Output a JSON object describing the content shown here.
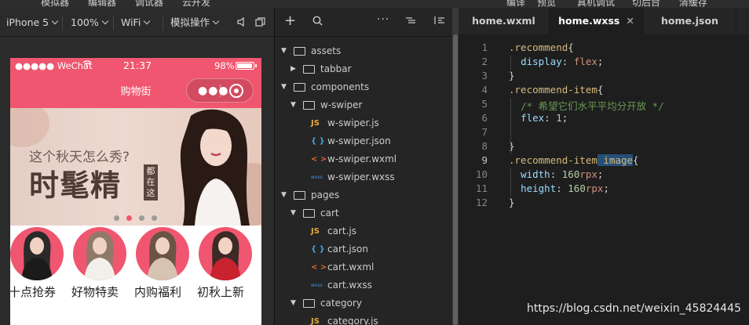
{
  "top_menu": [
    "模拟器",
    "编辑器",
    "调试器",
    "云开发",
    "编译",
    "预览",
    "真机调试",
    "切后台",
    "清缓存"
  ],
  "sim_toolbar": {
    "device": "iPhone 5",
    "zoom": "100%",
    "network": "WiFi",
    "operation": "模拟操作"
  },
  "phone": {
    "carrier": "●●●●● WeChat",
    "time": "21:37",
    "battery_text": "98%",
    "battery_level": 0.98,
    "nav_title": "购物街",
    "banner": {
      "subtitle": "这个秋天怎么秀?",
      "headline": "时髦精",
      "stamp": "都在这",
      "dots_count": 4,
      "active_dot": 1
    },
    "recommend": [
      {
        "label": "十点抢券"
      },
      {
        "label": "好物特卖"
      },
      {
        "label": "内购福利"
      },
      {
        "label": "初秋上新"
      }
    ]
  },
  "explorer": {
    "tree": [
      {
        "name": "assets",
        "type": "folder",
        "open": true,
        "depth": 0
      },
      {
        "name": "tabbar",
        "type": "folder",
        "open": false,
        "depth": 1
      },
      {
        "name": "components",
        "type": "folder",
        "open": true,
        "depth": 0
      },
      {
        "name": "w-swiper",
        "type": "folder",
        "open": true,
        "depth": 1
      },
      {
        "name": "w-swiper.js",
        "type": "js",
        "depth": 2
      },
      {
        "name": "w-swiper.json",
        "type": "json",
        "depth": 2
      },
      {
        "name": "w-swiper.wxml",
        "type": "wxml",
        "depth": 2
      },
      {
        "name": "w-swiper.wxss",
        "type": "wxss",
        "depth": 2
      },
      {
        "name": "pages",
        "type": "folder",
        "open": true,
        "depth": 0
      },
      {
        "name": "cart",
        "type": "folder",
        "open": true,
        "depth": 1
      },
      {
        "name": "cart.js",
        "type": "js",
        "depth": 2
      },
      {
        "name": "cart.json",
        "type": "json",
        "depth": 2
      },
      {
        "name": "cart.wxml",
        "type": "wxml",
        "depth": 2
      },
      {
        "name": "cart.wxss",
        "type": "wxss",
        "depth": 2
      },
      {
        "name": "category",
        "type": "folder",
        "open": true,
        "depth": 1
      },
      {
        "name": "category.js",
        "type": "js",
        "depth": 2
      }
    ],
    "file_icons": {
      "js": "JS",
      "json": "{ }",
      "wxml": "< >",
      "wxss": "wxss"
    },
    "icon_colors": {
      "js": "#e8a93a",
      "json": "#3ea7e0",
      "wxml": "#e06a2c",
      "wxss": "#4a8fd0"
    }
  },
  "editor": {
    "tabs": [
      {
        "label": "home.wxml",
        "active": false
      },
      {
        "label": "home.wxss",
        "active": true,
        "closable": true
      },
      {
        "label": "home.json",
        "active": false
      }
    ],
    "current_line": 9,
    "lines": [
      [
        {
          "t": ".recommend",
          "c": "sel"
        },
        {
          "t": "{",
          "c": ""
        }
      ],
      [
        {
          "t": "  ",
          "c": ""
        },
        {
          "t": "display",
          "c": "prop"
        },
        {
          "t": ": ",
          "c": ""
        },
        {
          "t": "flex",
          "c": "val"
        },
        {
          "t": ";",
          "c": ""
        }
      ],
      [
        {
          "t": "}",
          "c": ""
        }
      ],
      [
        {
          "t": ".recommend-item",
          "c": "sel"
        },
        {
          "t": "{",
          "c": ""
        }
      ],
      [
        {
          "t": "  ",
          "c": ""
        },
        {
          "t": "/* 希望它们水平平均分开放 */",
          "c": "cmt"
        }
      ],
      [
        {
          "t": "  ",
          "c": ""
        },
        {
          "t": "flex",
          "c": "prop"
        },
        {
          "t": ": ",
          "c": ""
        },
        {
          "t": "1",
          "c": "num"
        },
        {
          "t": ";",
          "c": ""
        }
      ],
      [
        {
          "t": "",
          "c": ""
        }
      ],
      [
        {
          "t": "}",
          "c": ""
        }
      ],
      [
        {
          "t": ".recommend-item",
          "c": "sel"
        },
        {
          "t": " image",
          "c": "hl"
        },
        {
          "t": "{",
          "c": ""
        }
      ],
      [
        {
          "t": "  ",
          "c": ""
        },
        {
          "t": "width",
          "c": "prop"
        },
        {
          "t": ": ",
          "c": ""
        },
        {
          "t": "160",
          "c": "num"
        },
        {
          "t": "rpx",
          "c": "unit"
        },
        {
          "t": ";",
          "c": ""
        }
      ],
      [
        {
          "t": "  ",
          "c": ""
        },
        {
          "t": "height",
          "c": "prop"
        },
        {
          "t": ": ",
          "c": ""
        },
        {
          "t": "160",
          "c": "num"
        },
        {
          "t": "rpx",
          "c": "unit"
        },
        {
          "t": ";",
          "c": ""
        }
      ],
      [
        {
          "t": "}",
          "c": ""
        }
      ]
    ]
  },
  "watermark": "https://blog.csdn.net/weixin_45824445",
  "colors": {
    "accent": "#f0566f",
    "editor_bg": "#1e1e1e",
    "selector": "#d7ba7d",
    "property": "#9cdcfe",
    "value": "#ce9178",
    "number": "#b5cea8",
    "comment": "#6a9955"
  }
}
